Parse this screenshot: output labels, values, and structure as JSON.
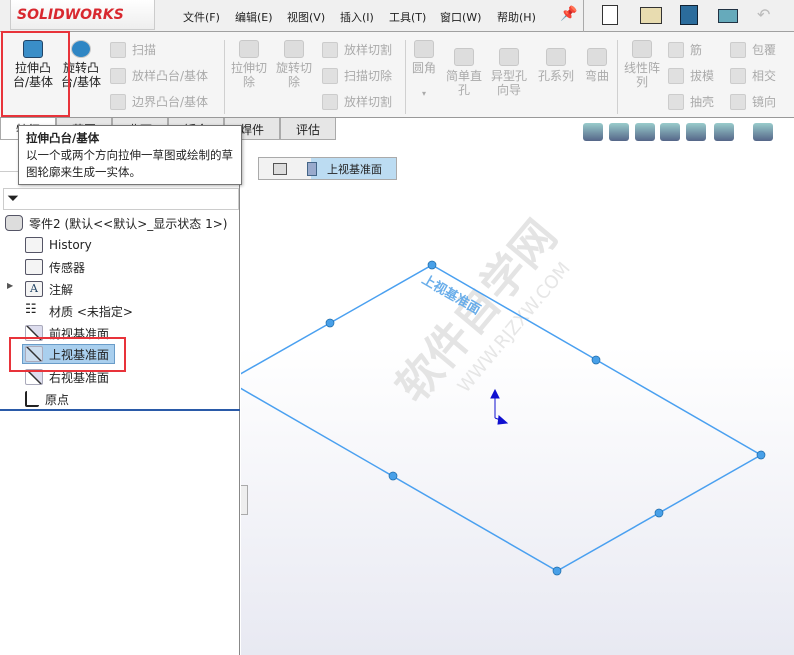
{
  "app": {
    "logo": "SOLIDWORKS",
    "menu": [
      "文件(F)",
      "编辑(E)",
      "视图(V)",
      "插入(I)",
      "工具(T)",
      "窗口(W)",
      "帮助(H)"
    ],
    "quick_icons": [
      "pin-icon",
      "new-file-icon",
      "open-file-icon",
      "save-icon",
      "print-icon",
      "undo-icon"
    ]
  },
  "ribbon": {
    "big": [
      "拉伸凸台/基体",
      "旋转凸台/基体",
      "拉伸切除",
      "旋转切除",
      "圆角",
      "简单直孔",
      "异型孔向导",
      "孔系列",
      "弯曲",
      "线性阵列"
    ],
    "small": [
      "扫描",
      "放样凸台/基体",
      "边界凸台/基体",
      "放样切割",
      "扫描切除",
      "放样切割",
      "筋",
      "拔模",
      "抽壳",
      "包覆",
      "相交",
      "镜向"
    ]
  },
  "tabs": [
    "特征",
    "草图",
    "曲面",
    "钣金",
    "焊件",
    "评估"
  ],
  "tooltip": {
    "title": "拉伸凸台/基体",
    "body": "以一个或两个方向拉伸一草图或绘制的草图轮廓来生成一实体。"
  },
  "tree": {
    "root": "零件2  (默认<<默认>_显示状态 1>)",
    "items": [
      "History",
      "传感器",
      "注解",
      "材质 <未指定>",
      "前视基准面",
      "上视基准面",
      "右视基准面",
      "原点"
    ],
    "selected": "上视基准面"
  },
  "breadcrumb": {
    "item": "上视基准面"
  },
  "viewport": {
    "plane_label": "上视基准面",
    "watermark": "软件自学网",
    "watermark_url": "WWW.RJZXW.COM",
    "plane_color": "#4aa0f0"
  },
  "accent": "#e8333a"
}
